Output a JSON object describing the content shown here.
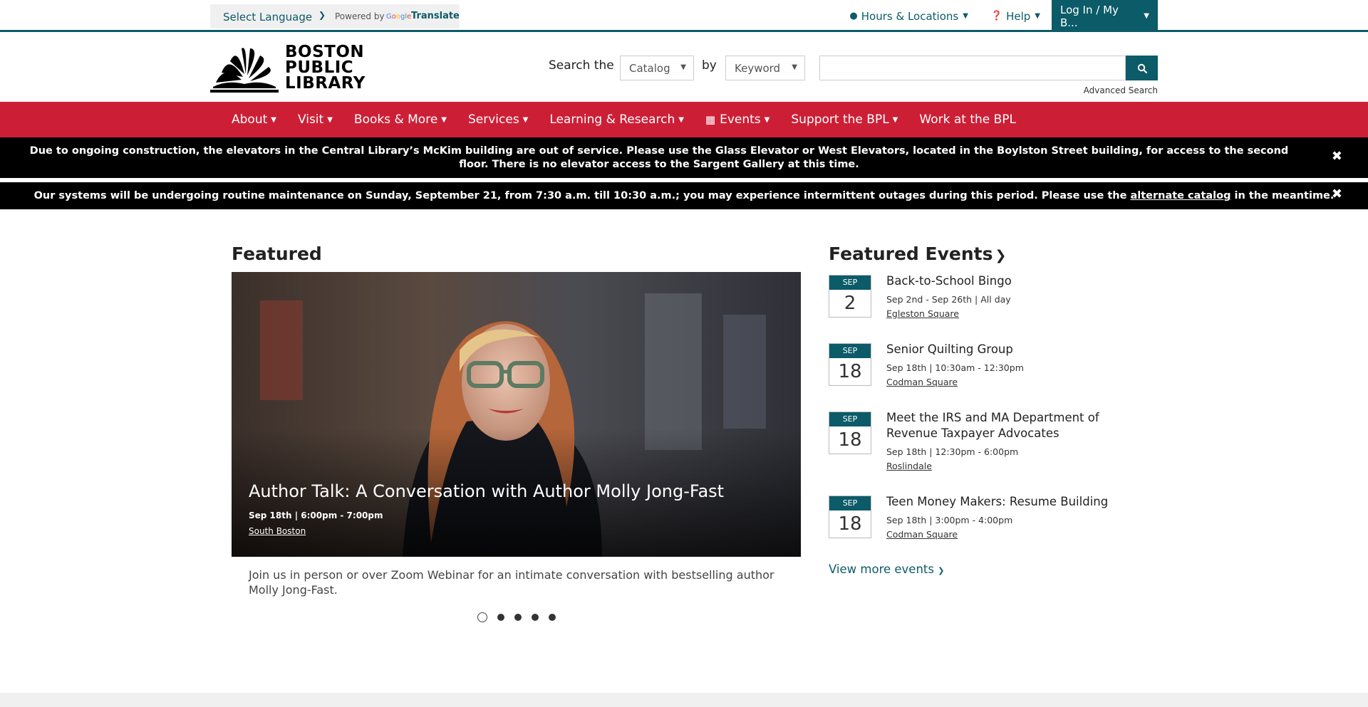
{
  "utility": {
    "select_language": "Select Language",
    "powered_by": "Powered by",
    "google": "Google",
    "translate": "Translate",
    "hours_locations": "Hours & Locations",
    "help": "Help",
    "login": "Log In / My B..."
  },
  "header": {
    "logo_line1": "BOSTON",
    "logo_line2": "PUBLIC",
    "logo_line3": "LIBRARY",
    "search_the": "Search the",
    "catalog": "Catalog",
    "by": "by",
    "keyword": "Keyword",
    "search_value": "",
    "advanced_search": "Advanced Search"
  },
  "nav": [
    "About",
    "Visit",
    "Books & More",
    "Services",
    "Learning & Research",
    "Events",
    "Support the BPL",
    "Work at the BPL"
  ],
  "alerts": {
    "construction": "Due to ongoing construction, the elevators in the Central Library’s McKim building are out of service. Please use the Glass Elevator or West Elevators, located in the Boylston Street building, for access to the second floor. There is no elevator access to the Sargent Gallery at this time.",
    "maintenance_before": "Our systems will be undergoing routine maintenance on Sunday, September 21, from 7:30 a.m. till 10:30 a.m.; you may experience intermittent outages during this period. Please use the ",
    "maintenance_link": "alternate catalog",
    "maintenance_after": " in the meantime."
  },
  "featured": {
    "heading": "Featured",
    "title": "Author Talk: A Conversation with Author Molly Jong-Fast",
    "date": "Sep 18th | 6:00pm - 7:00pm",
    "location": "South Boston",
    "description": "Join us in person or over Zoom Webinar for an intimate conversation with bestselling author Molly Jong-Fast."
  },
  "events": {
    "heading": "Featured Events",
    "items": [
      {
        "month": "SEP",
        "day": "2",
        "title": "Back-to-School Bingo",
        "meta": "Sep 2nd - Sep 26th | All day",
        "location": "Egleston Square"
      },
      {
        "month": "SEP",
        "day": "18",
        "title": "Senior Quilting Group",
        "meta": "Sep 18th | 10:30am - 12:30pm",
        "location": "Codman Square"
      },
      {
        "month": "SEP",
        "day": "18",
        "title": "Meet the IRS and MA Department of Revenue Taxpayer Advocates",
        "meta": "Sep 18th | 12:30pm - 6:00pm",
        "location": "Roslindale"
      },
      {
        "month": "SEP",
        "day": "18",
        "title": "Teen Money Makers: Resume Building",
        "meta": "Sep 18th | 3:00pm - 4:00pm",
        "location": "Codman Square"
      }
    ],
    "view_more": "View more events"
  },
  "colors": {
    "teal": "#0c5b68",
    "red": "#cc1f36"
  }
}
